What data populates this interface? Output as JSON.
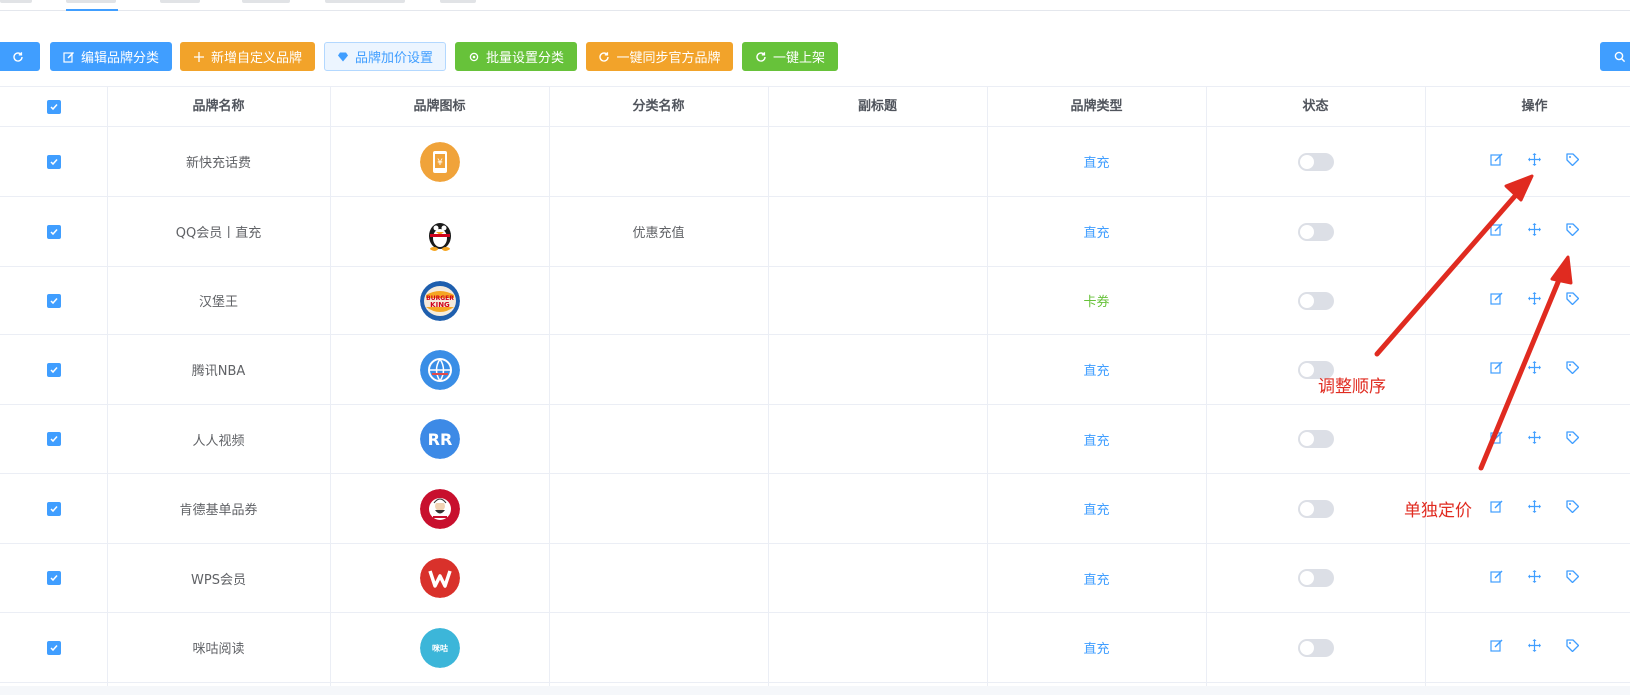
{
  "toolbar": {
    "refresh_label": "",
    "edit_category_label": "编辑品牌分类",
    "add_custom_label": "新增自定义品牌",
    "markup_settings_label": "品牌加价设置",
    "batch_category_label": "批量设置分类",
    "sync_official_label": "一键同步官方品牌",
    "publish_all_label": "一键上架"
  },
  "table": {
    "headers": {
      "name": "品牌名称",
      "icon": "品牌图标",
      "category": "分类名称",
      "subtitle": "副标题",
      "type": "品牌类型",
      "status": "状态",
      "actions": "操作"
    },
    "rows": [
      {
        "name": "新快充话费",
        "logo": "phone-recharge-logo",
        "category": "",
        "subtitle": "",
        "type": "直充",
        "type_color": "#409eff",
        "enabled": false
      },
      {
        "name": "QQ会员丨直充",
        "logo": "qq-penguin-logo",
        "category": "优惠充值",
        "subtitle": "",
        "type": "直充",
        "type_color": "#409eff",
        "enabled": false
      },
      {
        "name": "汉堡王",
        "logo": "burger-king-logo",
        "category": "",
        "subtitle": "",
        "type": "卡券",
        "type_color": "#67c23a",
        "enabled": false
      },
      {
        "name": "腾讯NBA",
        "logo": "tencent-nba-logo",
        "category": "",
        "subtitle": "",
        "type": "直充",
        "type_color": "#409eff",
        "enabled": false
      },
      {
        "name": "人人视频",
        "logo": "renren-video-logo",
        "category": "",
        "subtitle": "",
        "type": "直充",
        "type_color": "#409eff",
        "enabled": false
      },
      {
        "name": "肯德基单品券",
        "logo": "kfc-logo",
        "category": "",
        "subtitle": "",
        "type": "直充",
        "type_color": "#409eff",
        "enabled": false
      },
      {
        "name": "WPS会员",
        "logo": "wps-logo",
        "category": "",
        "subtitle": "",
        "type": "直充",
        "type_color": "#409eff",
        "enabled": false
      },
      {
        "name": "咪咕阅读",
        "logo": "migu-reading-logo",
        "category": "",
        "subtitle": "",
        "type": "直充",
        "type_color": "#409eff",
        "enabled": false
      }
    ]
  },
  "annotations": {
    "reorder_label": "调整顺序",
    "price_label": "单独定价",
    "color": "#e02b20"
  },
  "colors": {
    "primary": "#409eff",
    "warning": "#f2a32a",
    "success": "#67c23a"
  }
}
